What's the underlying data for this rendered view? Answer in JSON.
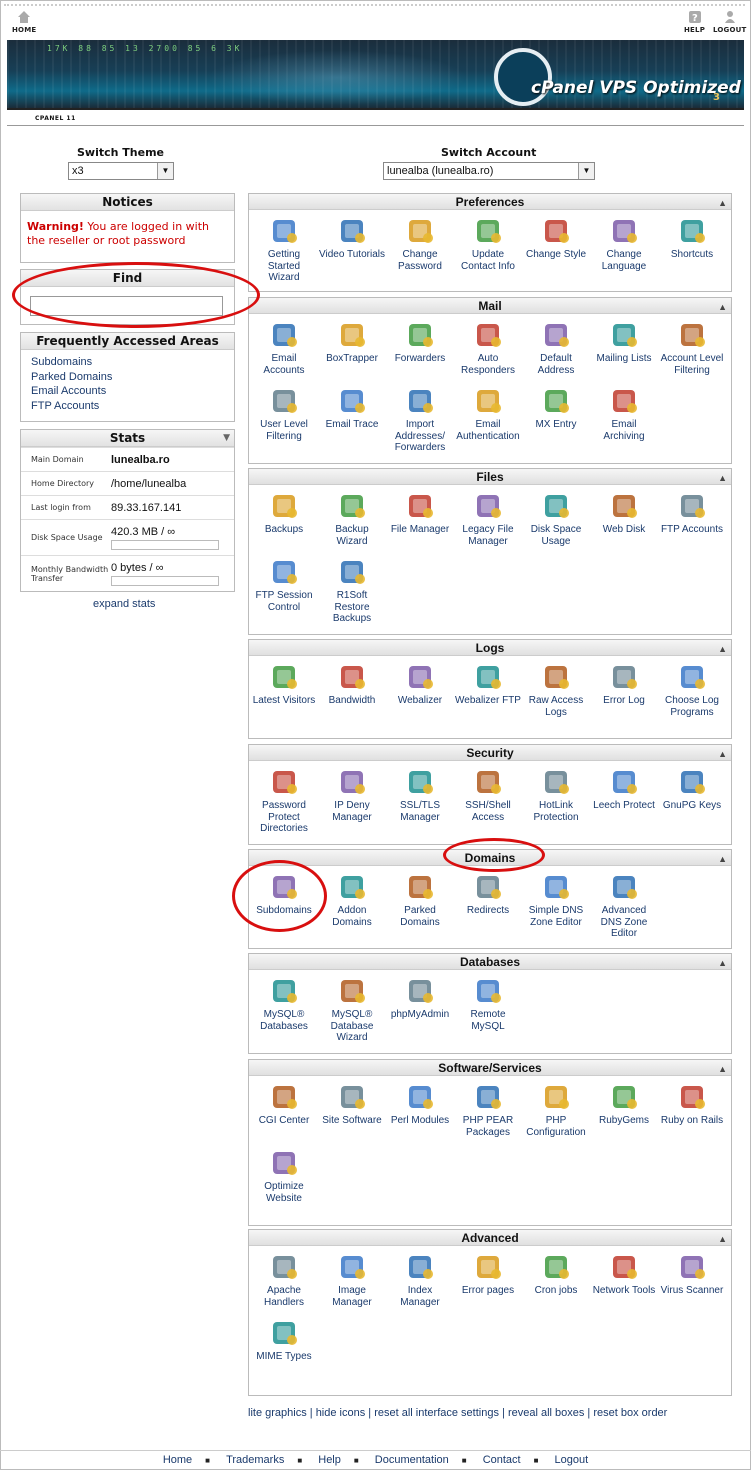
{
  "topnav": {
    "home": "HOME",
    "help": "HELP",
    "logout": "LOGOUT"
  },
  "banner": {
    "ticker": "17K   88   85   13   2700   85   6   3K",
    "brand": "cPanel VPS Optimized",
    "version": "3"
  },
  "version_label": "CPANEL 11",
  "switch_theme": {
    "label": "Switch Theme",
    "value": "x3"
  },
  "switch_account": {
    "label": "Switch Account",
    "value": "lunealba (lunealba.ro)"
  },
  "notices": {
    "title": "Notices",
    "warn_strong": "Warning!",
    "warn_text": " You are logged in with the reseller or root password"
  },
  "find": {
    "title": "Find",
    "placeholder": ""
  },
  "faa": {
    "title": "Frequently Accessed Areas",
    "items": [
      "Subdomains",
      "Parked Domains",
      "Email Accounts",
      "FTP Accounts"
    ]
  },
  "stats": {
    "title": "Stats",
    "rows": [
      {
        "k": "Main Domain",
        "v": "lunealba.ro"
      },
      {
        "k": "Home Directory",
        "v": "/home/lunealba"
      },
      {
        "k": "Last login from",
        "v": "89.33.167.141"
      },
      {
        "k": "Disk Space Usage",
        "v": "420.3 MB / ∞"
      },
      {
        "k": "Monthly Bandwidth Transfer",
        "v": "0 bytes / ∞"
      }
    ],
    "expand": "expand stats"
  },
  "groups": [
    {
      "title": "Preferences",
      "items": [
        "Getting Started Wizard",
        "Video Tutorials",
        "Change Password",
        "Update Contact Info",
        "Change Style",
        "Change Language",
        "Shortcuts"
      ]
    },
    {
      "title": "Mail",
      "items": [
        "Email Accounts",
        "BoxTrapper",
        "Forwarders",
        "Auto Responders",
        "Default Address",
        "Mailing Lists",
        "Account Level Filtering",
        "User Level Filtering",
        "Email Trace",
        "Import Addresses/ Forwarders",
        "Email Authentication",
        "MX Entry",
        "Email Archiving"
      ]
    },
    {
      "title": "Files",
      "items": [
        "Backups",
        "Backup Wizard",
        "File Manager",
        "Legacy File Manager",
        "Disk Space Usage",
        "Web Disk",
        "FTP Accounts",
        "FTP Session Control",
        "R1Soft Restore Backups"
      ]
    },
    {
      "title": "Logs",
      "items": [
        "Latest Visitors",
        "Bandwidth",
        "Webalizer",
        "Webalizer FTP",
        "Raw Access Logs",
        "Error Log",
        "Choose Log Programs"
      ]
    },
    {
      "title": "Security",
      "items": [
        "Password Protect Directories",
        "IP Deny Manager",
        "SSL/TLS Manager",
        "SSH/Shell Access",
        "HotLink Protection",
        "Leech Protect",
        "GnuPG Keys"
      ]
    },
    {
      "title": "Domains",
      "items": [
        "Subdomains",
        "Addon Domains",
        "Parked Domains",
        "Redirects",
        "Simple DNS Zone Editor",
        "Advanced DNS Zone Editor"
      ]
    },
    {
      "title": "Databases",
      "items": [
        "MySQL® Databases",
        "MySQL® Database Wizard",
        "phpMyAdmin",
        "Remote MySQL"
      ]
    },
    {
      "title": "Software/Services",
      "items": [
        "CGI Center",
        "Site Software",
        "Perl Modules",
        "PHP PEAR Packages",
        "PHP Configuration",
        "RubyGems",
        "Ruby on Rails",
        "Optimize Website"
      ]
    },
    {
      "title": "Advanced",
      "items": [
        "Apache Handlers",
        "Image Manager",
        "Index Manager",
        "Error pages",
        "Cron jobs",
        "Network Tools",
        "Virus Scanner",
        "MIME Types"
      ]
    }
  ],
  "footer_links": [
    "lite graphics",
    "hide icons",
    "reset all interface settings",
    "reveal all boxes",
    "reset box order"
  ],
  "footer_nav": [
    "Home",
    "Trademarks",
    "Help",
    "Documentation",
    "Contact",
    "Logout"
  ]
}
